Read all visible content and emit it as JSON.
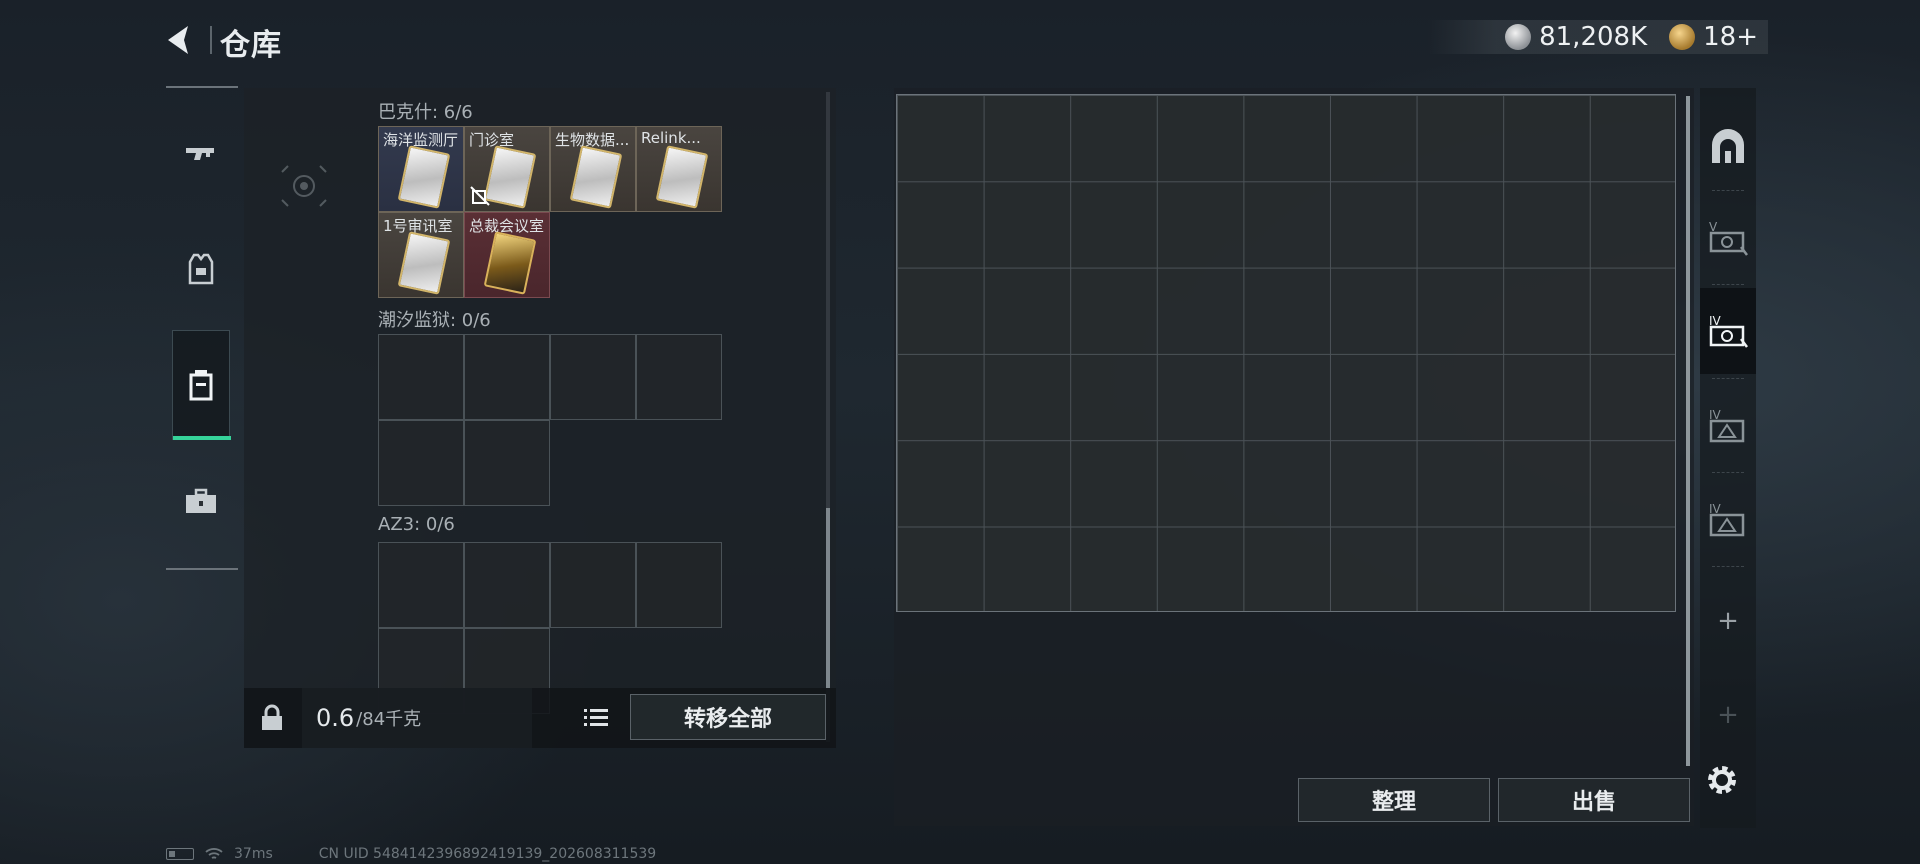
{
  "header": {
    "title": "仓库",
    "currency_value": "81,208K",
    "badge_value": "18+"
  },
  "categories": [
    {
      "name": "weapons",
      "icon": "gun-icon"
    },
    {
      "name": "equipment",
      "icon": "armor-vest-icon"
    },
    {
      "name": "containers",
      "icon": "container-icon",
      "active": true
    },
    {
      "name": "items",
      "icon": "toolbox-icon"
    }
  ],
  "storage": {
    "sections": [
      {
        "label": "巴克什: 6/6",
        "items": [
          {
            "name": "海洋监测厅"
          },
          {
            "name": "门诊室"
          },
          {
            "name": "生物数据..."
          },
          {
            "name": "Relink..."
          },
          {
            "name": "1号审讯室"
          },
          {
            "name": "总裁会议室"
          }
        ]
      },
      {
        "label": "潮汐监狱: 0/6"
      },
      {
        "label": "AZ3: 0/6"
      }
    ],
    "weight_current": "0.6",
    "weight_max": "/84千克",
    "transfer_all_label": "转移全部"
  },
  "container": {
    "columns": 9,
    "rows": 6,
    "sort_label": "整理",
    "sell_label": "出售"
  },
  "side_tabs": [
    {
      "name": "safe-house-tab",
      "icon": "arch-icon"
    },
    {
      "name": "case-v-tab",
      "icon": "case-v-icon",
      "numeral": "V"
    },
    {
      "name": "case-iv-tab",
      "icon": "case-iv-icon",
      "numeral": "IV",
      "active": true
    },
    {
      "name": "case-iv-b-tab",
      "icon": "case-iv-b-icon",
      "numeral": "IV"
    },
    {
      "name": "case-iv-c-tab",
      "icon": "case-iv-c-icon",
      "numeral": "IV"
    }
  ],
  "side_plus": "+",
  "status": {
    "ping": "37ms",
    "uid": "CN UID 5484142396892419139_202608311539"
  }
}
